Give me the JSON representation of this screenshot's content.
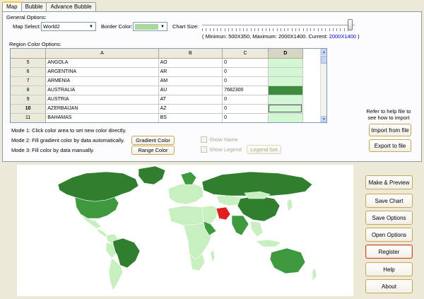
{
  "tabs": [
    {
      "label": "Map",
      "active": true
    },
    {
      "label": "Bubble",
      "active": false
    },
    {
      "label": "Advance Bubble",
      "active": false
    }
  ],
  "general": {
    "section_label": "General Options:",
    "map_select_label": "Map Select:",
    "map_select_value": "World2",
    "border_color_label": "Border Color:",
    "border_color_value": "#a8d99a",
    "chart_size_label": "Chart Size:",
    "chart_size_info_prefix": "( Minimun: 500X350, Maximum: 2000X1400. Current: ",
    "chart_size_current": "2000X1400",
    "chart_size_info_suffix": " )",
    "chart_size_level": 1.0
  },
  "region": {
    "section_label": "Region Color Options:",
    "columns": [
      "A",
      "B",
      "C",
      "D"
    ],
    "selected_column": "D",
    "rows": [
      {
        "num": "5",
        "name": "ANGOLA",
        "code": "AO",
        "value": "0",
        "color": "light"
      },
      {
        "num": "6",
        "name": "ARGENTINA",
        "code": "AR",
        "value": "0",
        "color": "light"
      },
      {
        "num": "7",
        "name": "ARMENIA",
        "code": "AM",
        "value": "0",
        "color": "light"
      },
      {
        "num": "8",
        "name": "AUSTRALIA",
        "code": "AU",
        "value": "7682300",
        "color": "dark"
      },
      {
        "num": "9",
        "name": "AUSTRIA",
        "code": "AT",
        "value": "0",
        "color": "light"
      },
      {
        "num": "10",
        "name": "AZERBAIJAN",
        "code": "AZ",
        "value": "0",
        "color": "light",
        "current": true
      },
      {
        "num": "11",
        "name": "BAHAMAS",
        "code": "BS",
        "value": "0",
        "color": "light"
      }
    ]
  },
  "modes": {
    "mode1": "Mode 1: Click color area to set new color directly.",
    "mode2": "Mode 2: Fill gradient color by data automatically.",
    "mode3": "Mode 3: Fill color by data manually.",
    "gradient_btn": "Gradient Color",
    "range_btn": "Range Color",
    "show_name": "Show Name",
    "show_legend": "Show Legend",
    "legend_set_btn": "Legend Set"
  },
  "help": {
    "text_line1": "Refer to help file to",
    "text_line2": "see how to import",
    "import_btn": "Import from file",
    "export_btn": "Export to file"
  },
  "actions": {
    "make_preview": "Make & Preview",
    "save_chart": "Save Chart",
    "save_options": "Save Options",
    "open_options": "Open Options",
    "register": "Register",
    "help": "Help",
    "about": "About"
  },
  "colors": {
    "map_light": "#c8efc0",
    "map_mid": "#3f9a3f",
    "map_dark": "#2f7f2f",
    "map_highlight": "#e02020",
    "link_blue": "#0000cc"
  }
}
